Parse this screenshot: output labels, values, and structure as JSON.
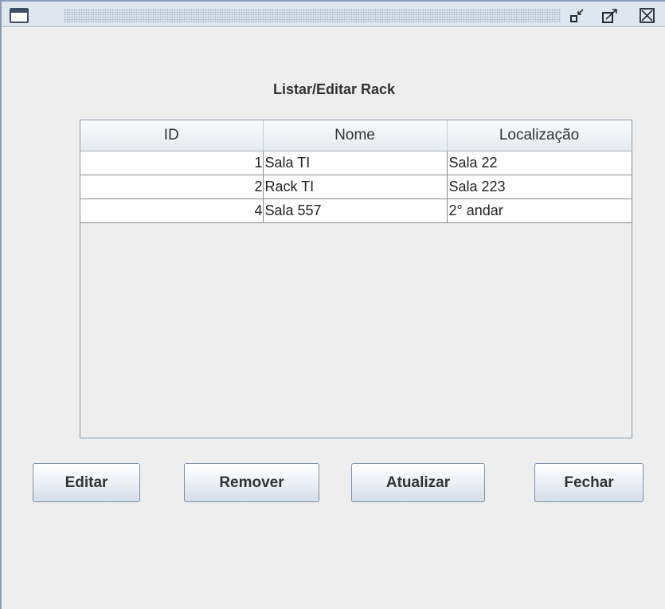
{
  "window": {
    "title": "",
    "icons": {
      "app": "window-icon",
      "minimize": "minimize-icon",
      "maximize": "maximize-icon",
      "close": "close-icon"
    }
  },
  "heading": "Listar/Editar Rack",
  "table": {
    "columns": [
      "ID",
      "Nome",
      "Localização"
    ],
    "rows": [
      {
        "id": "1",
        "nome": "Sala TI",
        "localizacao": "Sala 22"
      },
      {
        "id": "2",
        "nome": "Rack TI",
        "localizacao": "Sala 223"
      },
      {
        "id": "4",
        "nome": "Sala 557",
        "localizacao": "2° andar"
      }
    ]
  },
  "buttons": {
    "editar": "Editar",
    "remover": "Remover",
    "atualizar": "Atualizar",
    "fechar": "Fechar"
  }
}
